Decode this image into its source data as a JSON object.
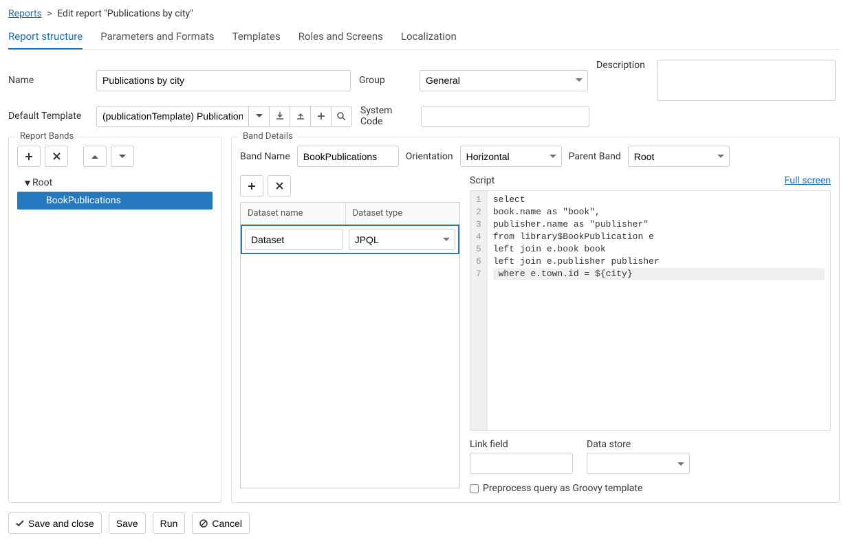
{
  "breadcrumb": {
    "reports_link": "Reports",
    "current": "Edit report \"Publications by city\""
  },
  "tabs": [
    "Report structure",
    "Parameters and Formats",
    "Templates",
    "Roles and Screens",
    "Localization"
  ],
  "active_tab_index": 0,
  "form": {
    "name_label": "Name",
    "name_value": "Publications by city",
    "group_label": "Group",
    "group_value": "General",
    "description_label": "Description",
    "description_value": "",
    "template_label": "Default Template",
    "template_value": "(publicationTemplate) Publication",
    "syscode_label": "System Code",
    "syscode_value": ""
  },
  "left_panel": {
    "legend": "Report Bands",
    "tree": {
      "root_label": "Root",
      "child_label": "BookPublications"
    }
  },
  "right_panel": {
    "legend": "Band Details",
    "band_name_label": "Band Name",
    "band_name_value": "BookPublications",
    "orientation_label": "Orientation",
    "orientation_value": "Horizontal",
    "parent_label": "Parent Band",
    "parent_value": "Root",
    "ds_table": {
      "col_name": "Dataset name",
      "col_type": "Dataset type",
      "row_name": "Dataset",
      "row_type": "JPQL"
    },
    "script": {
      "label": "Script",
      "fullscreen": "Full screen",
      "lines": [
        "select",
        "book.name as \"book\",",
        "publisher.name as \"publisher\"",
        "from library$BookPublication e",
        "left join e.book book",
        "left join e.publisher publisher",
        " where e.town.id = ${city}"
      ],
      "active_line_index": 6,
      "link_field_label": "Link field",
      "link_field_value": "",
      "data_store_label": "Data store",
      "data_store_value": "",
      "preprocess_label": "Preprocess query as Groovy template"
    }
  },
  "footer": {
    "save_close": "Save and close",
    "save": "Save",
    "run": "Run",
    "cancel": "Cancel"
  }
}
